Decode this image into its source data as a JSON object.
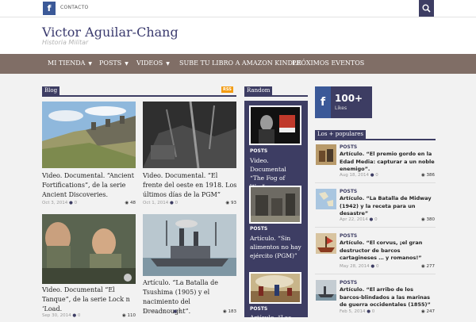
{
  "topbar": {
    "fb_icon": "f",
    "contact_label": "CONTACTO",
    "search_icon": "search-icon"
  },
  "site": {
    "title": "Victor Aguilar-Chang",
    "tagline": "Historia Militar"
  },
  "nav": {
    "items": [
      "MI TIENDA",
      "POSTS",
      "VIDEOS",
      "SUBE TU LIBRO A AMAZON KINDLE",
      "PRÓXIMOS EVENTOS"
    ]
  },
  "blog": {
    "label": "Blog",
    "rss": "RSS",
    "posts": [
      {
        "title": "Video. Documental. “Ancient Fortifications”, de la serie Ancient Discoveries.",
        "date": "Oct 3, 2014",
        "comments": "0",
        "views": "48"
      },
      {
        "title": "Video. Documental. “El frente del oeste en 1918. Los últimos días de la PGM”",
        "date": "Oct 1, 2014",
        "comments": "0",
        "views": "93"
      },
      {
        "title": "Video. Documental “El Tanque”, de la serie Lock n ‘Load.",
        "date": "Sep 30, 2014",
        "comments": "0",
        "views": "110"
      },
      {
        "title": "Artículo. “La Batalla de Tsushima (1905) y el nacimiento del Dreadnought”.",
        "date": "Sep 28, 2014",
        "comments": "0",
        "views": "183"
      }
    ]
  },
  "random": {
    "label": "Random",
    "items": [
      {
        "category": "POSTS",
        "title": "Video. Documental “The Fog of War”."
      },
      {
        "category": "POSTS",
        "title": "Artículo. “Sin alimentos no hay ejército (PGM)”"
      },
      {
        "category": "POSTS",
        "title": "Artículo. “Las"
      }
    ]
  },
  "facebook": {
    "icon": "f",
    "count": "100+",
    "label": "Likes"
  },
  "popular": {
    "label": "Los + populares",
    "items": [
      {
        "category": "POSTS",
        "title": "Artículo. “El premio gordo en la Edad Media: capturar a un noble enemigo”.",
        "date": "Aug 18, 2014",
        "comments": "0",
        "views": "386"
      },
      {
        "category": "POSTS",
        "title": "Artículo. “La Batalla de Midway (1942) y la receta para un desastre”",
        "date": "Apr 22, 2014",
        "comments": "0",
        "views": "380"
      },
      {
        "category": "POSTS",
        "title": "Artículo. “El corvus, ¡el gran destructor de barcos cartagineses … y romanos!”",
        "date": "May 28, 2014",
        "comments": "0",
        "views": "277"
      },
      {
        "category": "POSTS",
        "title": "Artículo. “El arribo de los barcos-blindados a las marinas de guerra occidentales (1855)”",
        "date": "Feb 5, 2014",
        "comments": "0",
        "views": "247"
      }
    ]
  },
  "colors": {
    "accent": "#3d3d63",
    "nav_bg": "#806e66",
    "facebook": "#3b5998",
    "rss": "#f39c12"
  }
}
